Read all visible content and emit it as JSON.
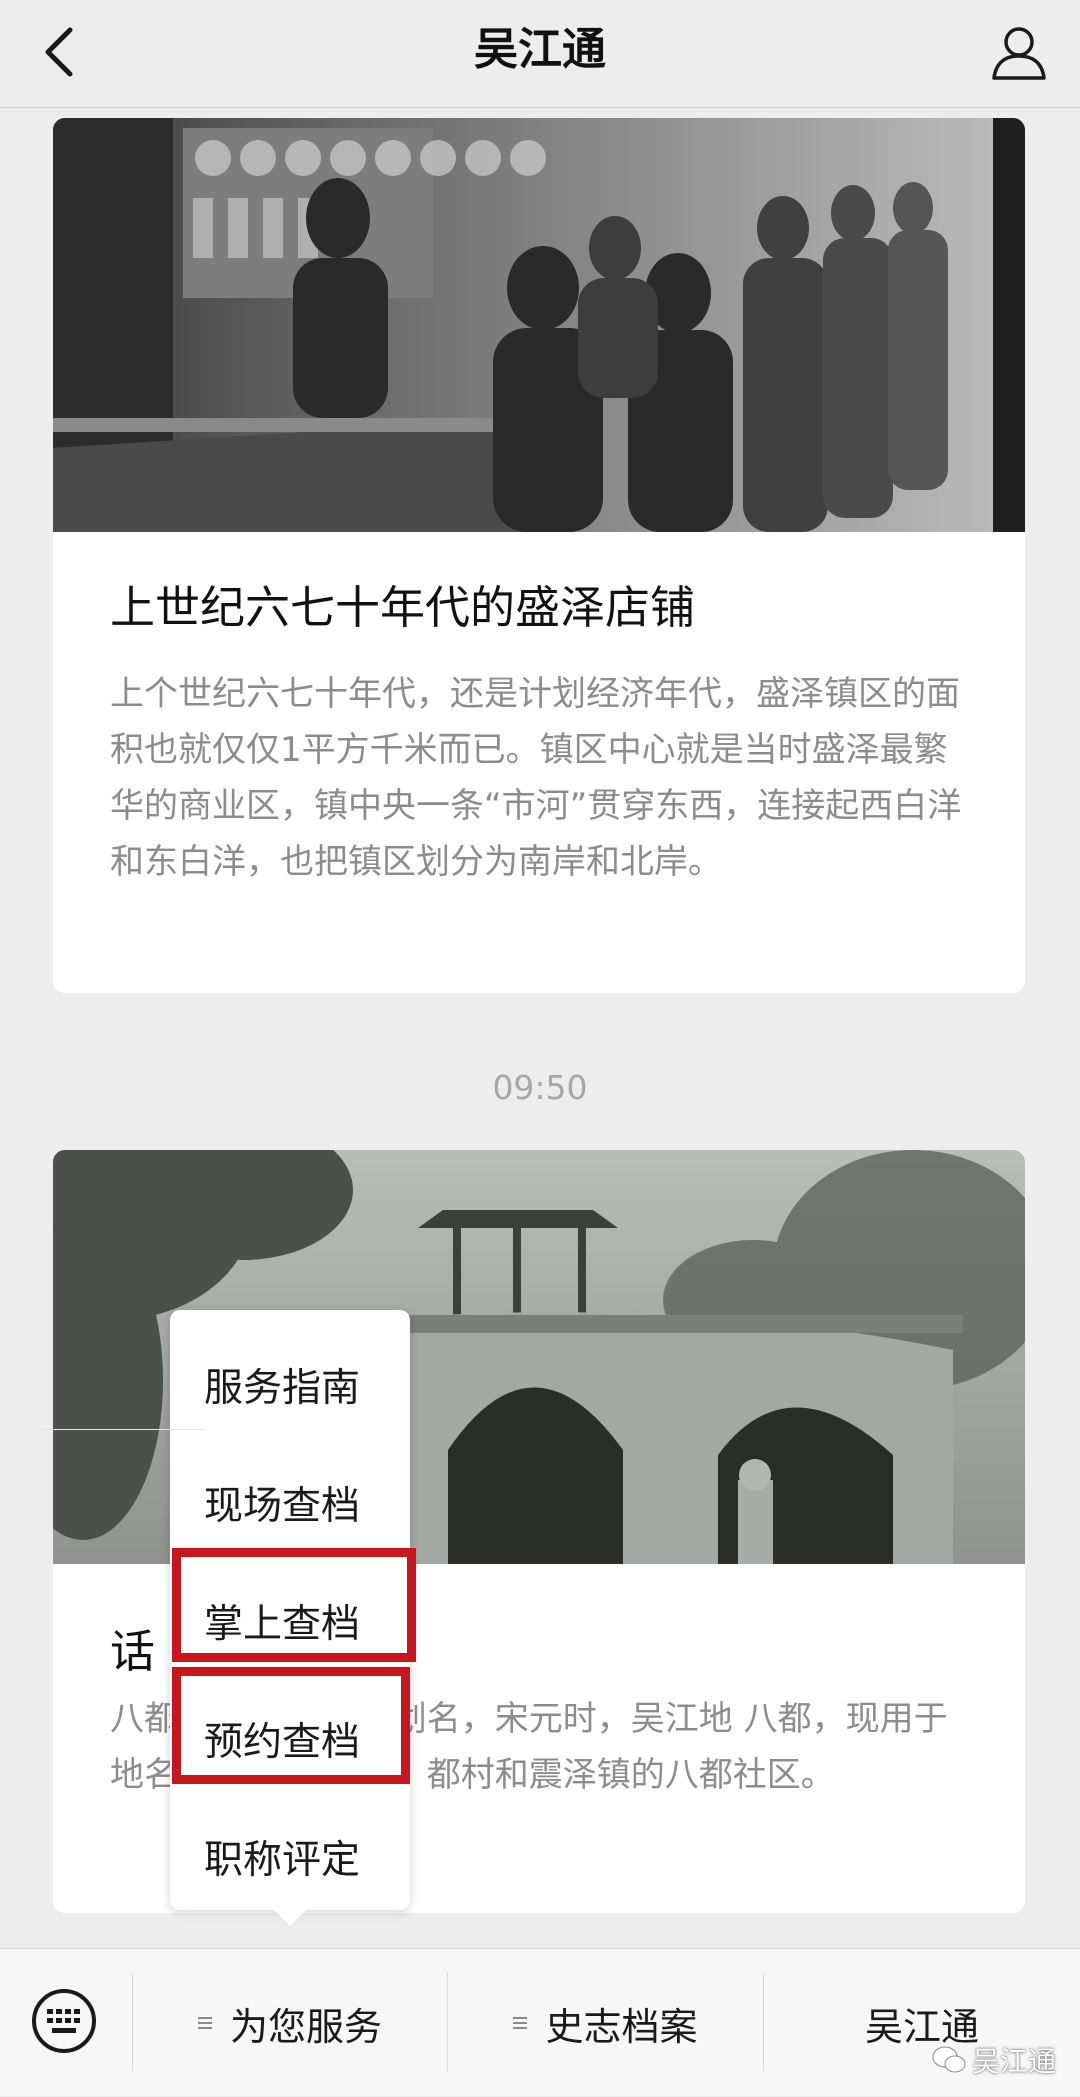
{
  "header": {
    "title": "吴江通"
  },
  "articles": [
    {
      "title": "上世纪六七十年代的盛泽店铺",
      "description": "上个世纪六七十年代，还是计划经济年代，盛泽镇区的面积也就仅仅1平方千米而已。镇区中心就是当时盛泽最繁华的商业区，镇中央一条“市河”贯穿东西，连接起西白洋和东白洋，也把镇区划分为南岸和北岸。"
    },
    {
      "title": "话",
      "description": "八都                    为古代行政区划名，宋元时，吴江地                    八都，现用于地名的惟有七都镇、                    都村和震泽镇的八都社区。"
    }
  ],
  "timestamp": "09:50",
  "popup_menu": {
    "items": [
      "服务指南",
      "现场查档",
      "掌上查档",
      "预约查档",
      "职称评定"
    ]
  },
  "bottom_menu": {
    "tabs": [
      "为您服务",
      "史志档案",
      "吴江通"
    ]
  },
  "watermark": {
    "text": "吴江通"
  },
  "colors": {
    "highlight": "#c9151e",
    "background": "#ededed"
  }
}
